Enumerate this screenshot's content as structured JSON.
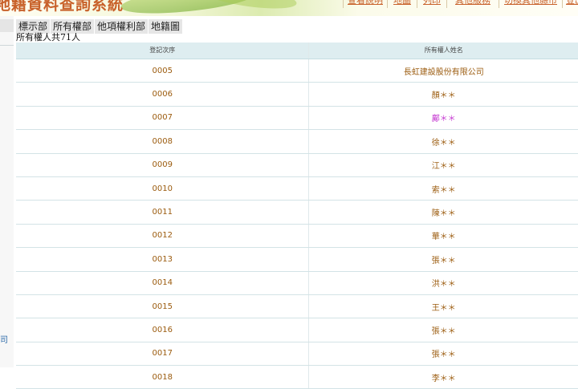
{
  "header": {
    "title": "地籍資料查詢系統",
    "nav": [
      "查看說明",
      "地圖",
      "列印",
      "其他服務",
      "切換其他縣市",
      "登出"
    ]
  },
  "sidebar": {
    "fragment": "公司"
  },
  "tabs": [
    "標示部",
    "所有權部",
    "他項權利部",
    "地籍圖"
  ],
  "summary": "所有權人共71人",
  "table": {
    "headers": [
      "登記次序",
      "所有權人姓名"
    ],
    "rows": [
      {
        "order": "0005",
        "name": "長虹建設股份有限公司"
      },
      {
        "order": "0006",
        "name": "顏＊＊"
      },
      {
        "order": "0007",
        "name": "鄺＊＊",
        "highlight": "#c53ad1"
      },
      {
        "order": "0008",
        "name": "徐＊＊"
      },
      {
        "order": "0009",
        "name": "江＊＊"
      },
      {
        "order": "0010",
        "name": "索＊＊"
      },
      {
        "order": "0011",
        "name": "陳＊＊"
      },
      {
        "order": "0012",
        "name": "華＊＊"
      },
      {
        "order": "0013",
        "name": "張＊＊"
      },
      {
        "order": "0014",
        "name": "洪＊＊"
      },
      {
        "order": "0015",
        "name": "王＊＊"
      },
      {
        "order": "0016",
        "name": "張＊＊"
      },
      {
        "order": "0017",
        "name": "張＊＊"
      },
      {
        "order": "0018",
        "name": "李＊＊"
      }
    ]
  },
  "colors": {
    "accent": "#c8612a",
    "cell_text": "#9b5b0e",
    "table_header_bg": "#deedf0",
    "tab_bg": "#e6e6e6"
  }
}
